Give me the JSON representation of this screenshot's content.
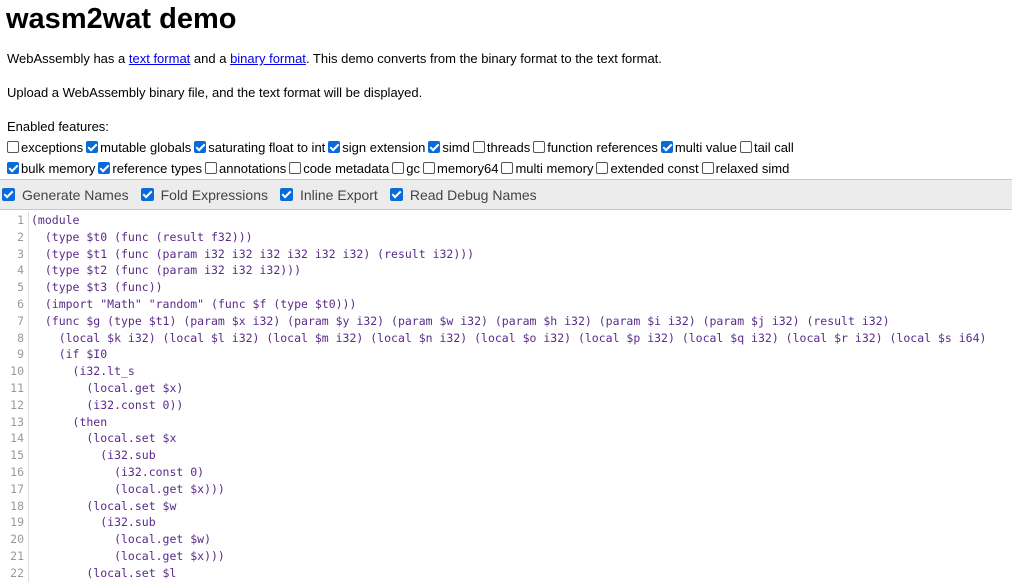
{
  "page": {
    "title": "wasm2wat demo",
    "intro_prefix": "WebAssembly has a ",
    "intro_link1": "text format",
    "intro_mid": " and a ",
    "intro_link2": "binary format",
    "intro_suffix": ". This demo converts from the binary format to the text format.",
    "upload_text": "Upload a WebAssembly binary file, and the text format will be displayed.",
    "features_label": "Enabled features:"
  },
  "features_row1": [
    {
      "label": "exceptions",
      "checked": false
    },
    {
      "label": "mutable globals",
      "checked": true
    },
    {
      "label": "saturating float to int",
      "checked": true
    },
    {
      "label": "sign extension",
      "checked": true
    },
    {
      "label": "simd",
      "checked": true
    },
    {
      "label": "threads",
      "checked": false
    },
    {
      "label": "function references",
      "checked": false
    },
    {
      "label": "multi value",
      "checked": true
    },
    {
      "label": "tail call",
      "checked": false
    }
  ],
  "features_row2": [
    {
      "label": "bulk memory",
      "checked": true
    },
    {
      "label": "reference types",
      "checked": true
    },
    {
      "label": "annotations",
      "checked": false
    },
    {
      "label": "code metadata",
      "checked": false
    },
    {
      "label": "gc",
      "checked": false
    },
    {
      "label": "memory64",
      "checked": false
    },
    {
      "label": "multi memory",
      "checked": false
    },
    {
      "label": "extended const",
      "checked": false
    },
    {
      "label": "relaxed simd",
      "checked": false
    }
  ],
  "options": [
    {
      "label": "Generate Names",
      "checked": true
    },
    {
      "label": "Fold Expressions",
      "checked": true
    },
    {
      "label": "Inline Export",
      "checked": true
    },
    {
      "label": "Read Debug Names",
      "checked": true
    }
  ],
  "code_lines": [
    "(module",
    "  (type $t0 (func (result f32)))",
    "  (type $t1 (func (param i32 i32 i32 i32 i32 i32) (result i32)))",
    "  (type $t2 (func (param i32 i32 i32)))",
    "  (type $t3 (func))",
    "  (import \"Math\" \"random\" (func $f (type $t0)))",
    "  (func $g (type $t1) (param $x i32) (param $y i32) (param $w i32) (param $h i32) (param $i i32) (param $j i32) (result i32)",
    "    (local $k i32) (local $l i32) (local $m i32) (local $n i32) (local $o i32) (local $p i32) (local $q i32) (local $r i32) (local $s i64)",
    "    (if $I0",
    "      (i32.lt_s",
    "        (local.get $x)",
    "        (i32.const 0))",
    "      (then",
    "        (local.set $x",
    "          (i32.sub",
    "            (i32.const 0)",
    "            (local.get $x)))",
    "        (local.set $w",
    "          (i32.sub",
    "            (local.get $w)",
    "            (local.get $x)))",
    "        (local.set $l"
  ],
  "colors": {
    "accent": "#0a6ad8",
    "link": "#0000ee",
    "code": "#5a2a8a",
    "toolbar_bg": "#ececec"
  }
}
